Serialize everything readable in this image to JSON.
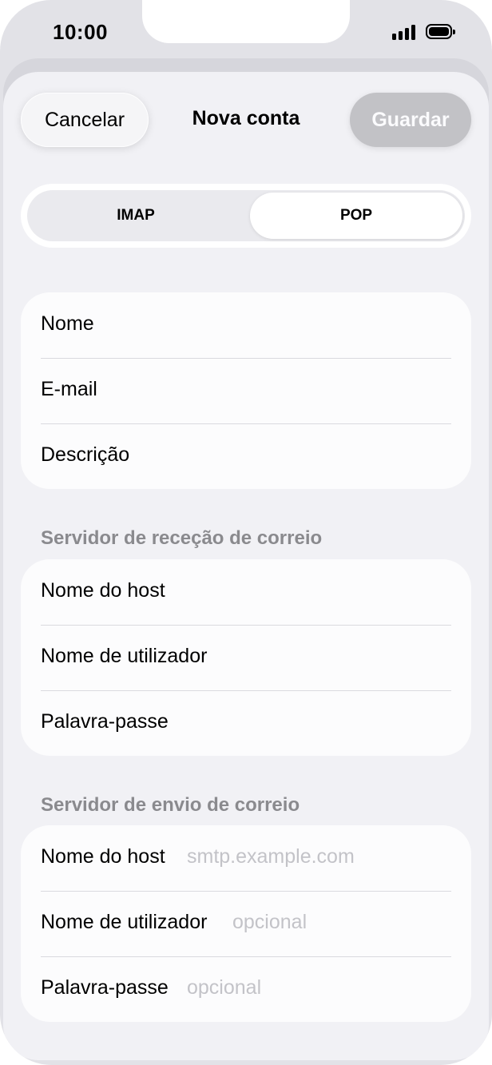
{
  "status_bar": {
    "time": "10:00"
  },
  "nav": {
    "cancel_label": "Cancelar",
    "title": "Nova conta",
    "save_label": "Guardar"
  },
  "segmented": {
    "options": [
      "IMAP",
      "POP"
    ],
    "selected": "POP"
  },
  "account": {
    "rows": [
      {
        "label": "Nome"
      },
      {
        "label": "E-mail"
      },
      {
        "label": "Descrição"
      }
    ]
  },
  "incoming": {
    "header": "Servidor de receção de correio",
    "rows": [
      {
        "label": "Nome do host"
      },
      {
        "label": "Nome de utilizador"
      },
      {
        "label": "Palavra-passe"
      }
    ]
  },
  "outgoing": {
    "header": "Servidor de envio de correio",
    "rows": [
      {
        "label": "Nome do host",
        "placeholder": "smtp.example.com"
      },
      {
        "label": "Nome de utilizador",
        "placeholder": "opcional"
      },
      {
        "label": "Palavra-passe",
        "placeholder": "opcional"
      }
    ]
  },
  "colors": {
    "background": "#e2e2e7",
    "sheet": "#f1f1f5",
    "card": "#fcfcfd",
    "secondary_text": "#8a8a8e",
    "placeholder": "#c3c3c8",
    "disabled_button": "#c2c2c6"
  },
  "icons": [
    "cellular-signal-icon",
    "battery-icon"
  ]
}
